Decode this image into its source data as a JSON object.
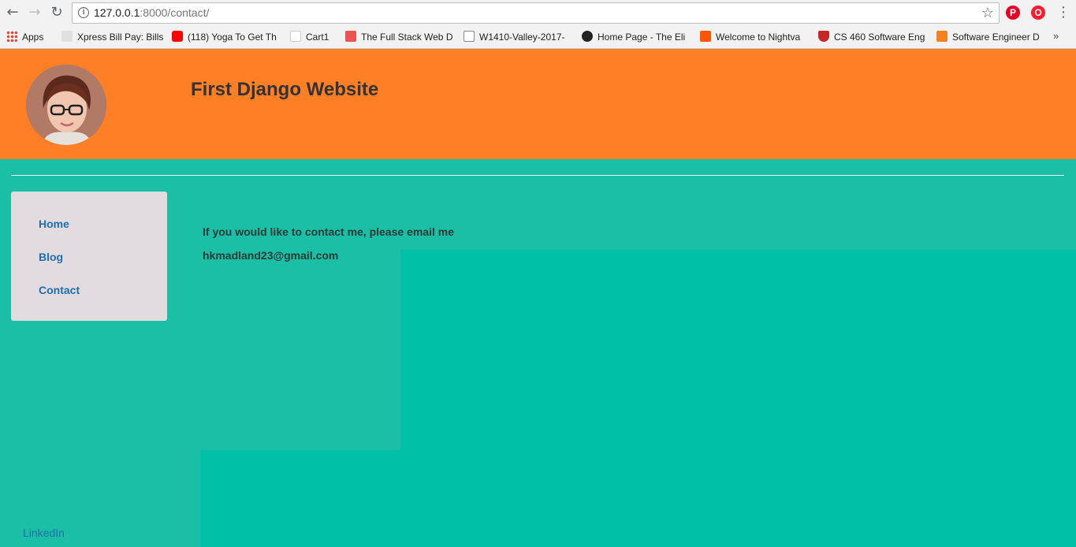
{
  "browser": {
    "url_host": "127.0.0.1",
    "url_rest": ":8000/contact/",
    "bookmarks": [
      {
        "label": "Apps",
        "color": "#4285f4"
      },
      {
        "label": "Xpress Bill Pay: Bills",
        "color": "#9e9e9e"
      },
      {
        "label": "(118) Yoga To Get Th",
        "color": "#ff0000"
      },
      {
        "label": "Cart1",
        "color": "#222222"
      },
      {
        "label": "The Full Stack Web D",
        "color": "#ec5252"
      },
      {
        "label": "W1410-Valley-2017-",
        "color": "#ffffff"
      },
      {
        "label": "Home Page - The Eli",
        "color": "#222222"
      },
      {
        "label": "Welcome to Nightva",
        "color": "#ff5500"
      },
      {
        "label": "CS 460 Software Eng",
        "color": "#c62828"
      },
      {
        "label": "Software Engineer D",
        "color": "#f48024"
      }
    ],
    "more_label": "»"
  },
  "site": {
    "title": "First Django Website",
    "header_color": "#fe7f26",
    "background_color": "#1bbfa6"
  },
  "sidebar": {
    "items": [
      {
        "label": "Home"
      },
      {
        "label": "Blog"
      },
      {
        "label": "Contact"
      }
    ]
  },
  "main": {
    "contact_text": "If you would like to contact me, please email me",
    "email": "hkmadland23@gmail.com"
  },
  "footer": {
    "linkedin": "LinkedIn"
  }
}
